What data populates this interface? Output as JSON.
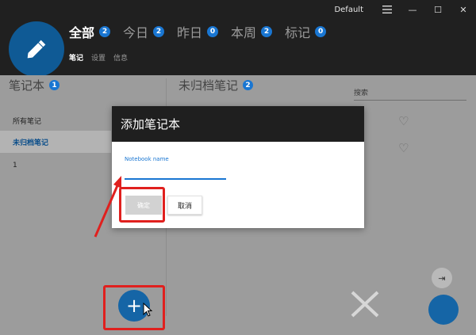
{
  "titlebar": {
    "theme": "Default",
    "menu_icon": "hamburger-icon",
    "minimize": "—",
    "maximize": "☐",
    "close": "✕"
  },
  "tabs": [
    {
      "label": "全部",
      "count": "2"
    },
    {
      "label": "今日",
      "count": "2"
    },
    {
      "label": "昨日",
      "count": "0"
    },
    {
      "label": "本周",
      "count": "2"
    },
    {
      "label": "标记",
      "count": "0"
    }
  ],
  "subnav": {
    "notes": "笔记",
    "settings": "设置",
    "info": "信息"
  },
  "notebooks": {
    "title": "笔记本",
    "count": "1",
    "items": [
      {
        "label": "所有笔记"
      },
      {
        "label": "未归档笔记"
      },
      {
        "label": "1"
      }
    ]
  },
  "notes": {
    "title": "未归档笔记",
    "count": "2",
    "search_placeholder": "搜索"
  },
  "dialog": {
    "title": "添加笔记本",
    "input_label": "Notebook name",
    "input_value": "",
    "ok_label": "确定",
    "cancel_label": "取消"
  },
  "fab": {
    "label": "+"
  },
  "colors": {
    "accent": "#1976d2",
    "header": "#202020",
    "highlight": "#e0201e"
  }
}
